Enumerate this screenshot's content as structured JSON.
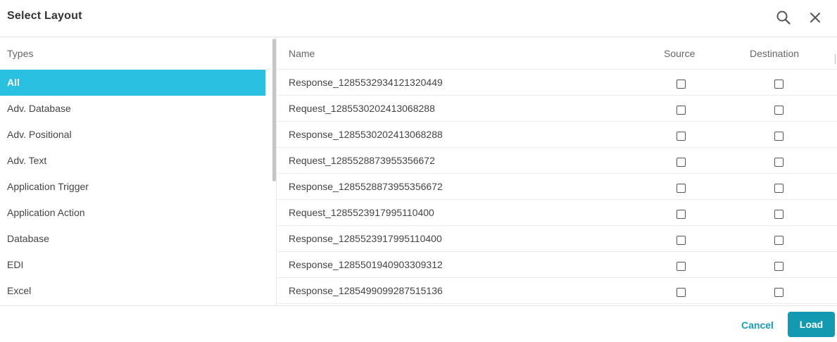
{
  "dialog": {
    "title": "Select Layout",
    "icons": {
      "search": "search-icon",
      "close": "close-icon"
    }
  },
  "types": {
    "header": "Types",
    "selected": "All",
    "items": [
      {
        "label": "All"
      },
      {
        "label": "Adv. Database"
      },
      {
        "label": "Adv. Positional"
      },
      {
        "label": "Adv. Text"
      },
      {
        "label": "Application Trigger"
      },
      {
        "label": "Application Action"
      },
      {
        "label": "Database"
      },
      {
        "label": "EDI"
      },
      {
        "label": "Excel"
      }
    ]
  },
  "table": {
    "columns": {
      "name": "Name",
      "source": "Source",
      "destination": "Destination"
    },
    "rows": [
      {
        "name": "Response_1285532934121320449",
        "source": false,
        "destination": false
      },
      {
        "name": "Request_1285530202413068288",
        "source": false,
        "destination": false
      },
      {
        "name": "Response_1285530202413068288",
        "source": false,
        "destination": false
      },
      {
        "name": "Request_1285528873955356672",
        "source": false,
        "destination": false
      },
      {
        "name": "Response_1285528873955356672",
        "source": false,
        "destination": false
      },
      {
        "name": "Request_1285523917995110400",
        "source": false,
        "destination": false
      },
      {
        "name": "Response_1285523917995110400",
        "source": false,
        "destination": false
      },
      {
        "name": "Response_1285501940903309312",
        "source": false,
        "destination": false
      },
      {
        "name": "Response_1285499099287515136",
        "source": false,
        "destination": false
      }
    ]
  },
  "footer": {
    "cancel_label": "Cancel",
    "load_label": "Load"
  },
  "colors": {
    "accent": "#29c0e2",
    "primary_button": "#1399b2",
    "link": "#1a9bb5"
  }
}
